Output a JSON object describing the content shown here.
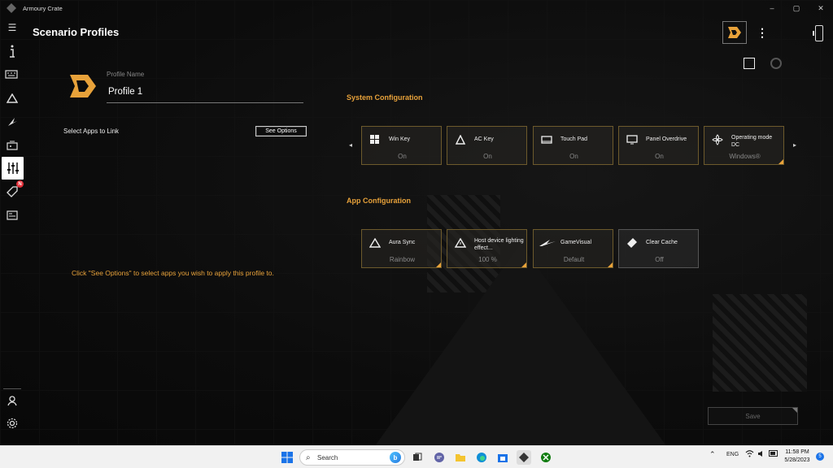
{
  "window": {
    "title": "Armoury Crate",
    "controls": [
      "–",
      "▢",
      "✕"
    ]
  },
  "header": {
    "title": "Scenario Profiles"
  },
  "profile": {
    "name_label": "Profile Name",
    "name_value": "Profile 1",
    "apps_link_label": "Select Apps to Link",
    "see_options_label": "See Options",
    "hint": "Click \"See Options\" to select apps you wish to apply this profile to."
  },
  "system_config": {
    "title": "System Configuration",
    "cards": [
      {
        "label": "Win Key",
        "value": "On",
        "icon": "windows-icon"
      },
      {
        "label": "AC Key",
        "value": "On",
        "icon": "ac-key-icon"
      },
      {
        "label": "Touch Pad",
        "value": "On",
        "icon": "touchpad-icon"
      },
      {
        "label": "Panel Overdrive",
        "value": "On",
        "icon": "panel-overdrive-icon"
      },
      {
        "label": "Operating mode DC",
        "value": "Windows®",
        "icon": "fan-icon"
      }
    ]
  },
  "app_config": {
    "title": "App Configuration",
    "cards": [
      {
        "label": "Aura Sync",
        "value": "Rainbow",
        "icon": "aura-sync-icon"
      },
      {
        "label": "Host device lighting effect...",
        "value": "100 %",
        "icon": "lighting-icon"
      },
      {
        "label": "GameVisual",
        "value": "Default",
        "icon": "gamevisual-icon"
      },
      {
        "label": "Clear Cache",
        "value": "Off",
        "icon": "clear-cache-icon"
      }
    ]
  },
  "save_label": "Save",
  "sidebar_badge": "N",
  "taskbar": {
    "search_placeholder": "Search",
    "bing_label": "b",
    "lang": "ENG",
    "time": "11:58 PM",
    "date": "5/28/2023",
    "notifications": "5"
  },
  "colors": {
    "accent": "#e8a23a",
    "background": "#0b0b0b"
  }
}
